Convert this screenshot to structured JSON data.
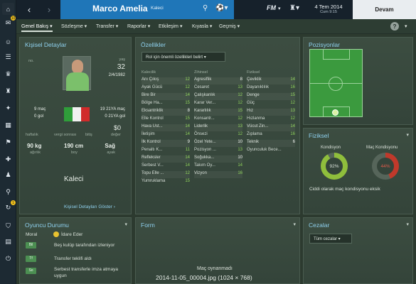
{
  "sidebar": {
    "inbox_badge": "10",
    "notification_badge": "1",
    "icons": [
      "home-icon",
      "inbox-icon",
      "people-icon",
      "squad-icon",
      "trophy-icon",
      "team-icon",
      "tactics-icon",
      "staff-icon",
      "calendar-icon",
      "training-icon",
      "scout-icon",
      "transfer-icon",
      "finance-icon",
      "search-icon",
      "notification-icon",
      "shield-icon",
      "club-icon",
      "game-icon"
    ]
  },
  "header": {
    "player_name": "Marco Amelia",
    "player_position": "Kaleci",
    "date_main": "4 Tem 2014",
    "date_sub": "Cum 9:15",
    "continue_label": "Devam",
    "logo_label": "FM"
  },
  "menu": {
    "items": [
      "Genel Bakış",
      "Sözleşme",
      "Transfer",
      "Raporlar",
      "Etkileşim",
      "Kıyasla",
      "Geçmiş"
    ],
    "help": "?"
  },
  "personal": {
    "title": "Kişisel Detaylar",
    "no_label": "no.",
    "age_label": "yaş",
    "age": "32",
    "dob": "2/4/1982",
    "matches": "9 maç",
    "u21_matches": "19 21YA maç",
    "goals": "0 gol",
    "u21_goals": "0 21YA gol",
    "weekly": "haftalık",
    "tax": "vergi sonrası",
    "end": "bitiş",
    "value_amount": "$0",
    "value_label": "değer",
    "weight": "90 kg",
    "weight_label": "ağırlık",
    "height": "190 cm",
    "height_label": "boy",
    "foot": "Sağ",
    "foot_label": "ayak",
    "position": "Kaleci",
    "show_link": "Kişisel Detayları Göster ›"
  },
  "attributes": {
    "title": "Özellikler",
    "filter": "Rol için önemli özellikleri belirt",
    "col1_title": "Kalecilik",
    "col2_title": "Zihinsel",
    "col3_title": "Fiziksel",
    "col1": [
      {
        "name": "Anı Çıkış",
        "value": "12"
      },
      {
        "name": "Ayak Gücü",
        "value": "12"
      },
      {
        "name": "Bire Bir",
        "value": "14"
      },
      {
        "name": "Bölge Ha...",
        "value": "15"
      },
      {
        "name": "Eksantriklik",
        "value": "8"
      },
      {
        "name": "Elle Kontrol",
        "value": "15"
      },
      {
        "name": "Hava Ust...",
        "value": "14"
      },
      {
        "name": "İletişim",
        "value": "14"
      },
      {
        "name": "İlk Kontrol",
        "value": "9"
      },
      {
        "name": "Penaltı K...",
        "value": "11"
      },
      {
        "name": "Refleksler",
        "value": "14"
      },
      {
        "name": "Serbest V...",
        "value": "14"
      },
      {
        "name": "Topu Elle ...",
        "value": "12"
      },
      {
        "name": "Yumruklama",
        "value": "15"
      }
    ],
    "col2": [
      {
        "name": "Agresiflik",
        "value": "8"
      },
      {
        "name": "Cesaret",
        "value": "13"
      },
      {
        "name": "Çalışkanlık",
        "value": "12"
      },
      {
        "name": "Karar Ver...",
        "value": "12"
      },
      {
        "name": "Kararlılık",
        "value": "15"
      },
      {
        "name": "Konsantr...",
        "value": "12"
      },
      {
        "name": "Liderlik",
        "value": "13"
      },
      {
        "name": "Önsezi",
        "value": "12"
      },
      {
        "name": "Özel Yete...",
        "value": "10"
      },
      {
        "name": "Pozisyon ...",
        "value": "13"
      },
      {
        "name": "Soğukka...",
        "value": "10"
      },
      {
        "name": "Takım Oy...",
        "value": "14"
      },
      {
        "name": "Vizyon",
        "value": "16"
      }
    ],
    "col3": [
      {
        "name": "Çeviklik",
        "value": "14"
      },
      {
        "name": "Dayanıklılık",
        "value": "16"
      },
      {
        "name": "Denge",
        "value": "15"
      },
      {
        "name": "Güç",
        "value": "12"
      },
      {
        "name": "Hız",
        "value": "13"
      },
      {
        "name": "Hızlanma",
        "value": "12"
      },
      {
        "name": "Vücut Zin...",
        "value": "14"
      },
      {
        "name": "Zıplama",
        "value": "16"
      },
      {
        "name": "Teknik",
        "value": "6"
      },
      {
        "name": "Oyunculuk Bece...",
        "value": ""
      }
    ]
  },
  "positions": {
    "title": "Pozisyonlar"
  },
  "physical": {
    "title": "Fiziksel",
    "condition_label": "Kondisyon",
    "condition_value": "92%",
    "condition_pct": 92,
    "match_cond_label": "Maç Kondisyonu",
    "match_cond_value": "44%",
    "match_cond_pct": 44,
    "note": "Ciddi olarak maç kondisyonu eksik"
  },
  "status": {
    "title": "Oyuncu Durumu",
    "morale_label": "Moral",
    "morale_value": "İdare Eder",
    "rows": [
      {
        "badge": "Bil",
        "text": "Beş kulüp tarafından izleniyor"
      },
      {
        "badge": "Tf",
        "text": "Transfer teklifi aldı"
      },
      {
        "badge": "So",
        "text": "Serbest transferle imza atmaya uygun"
      }
    ]
  },
  "form": {
    "title": "Form",
    "empty_text": "Maç oynanmadı",
    "caption": "2014-11-05_00004.jpg (1024 × 768)"
  },
  "bans": {
    "title": "Cezalar",
    "dropdown": "Tüm cezalar"
  },
  "colors": {
    "accent_blue": "#1f76b8",
    "attribute_green": "#8fd25b",
    "condition_green": "#8fbe3c",
    "match_cond_red": "#c0392b"
  }
}
